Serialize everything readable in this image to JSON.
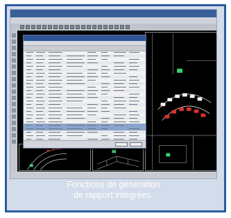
{
  "caption": {
    "line1": "Fonctions de génération",
    "line2": "de rapport intégrées."
  },
  "colors": {
    "frame_border": "#2c5aa0",
    "frame_background": "#d3dcea",
    "cad_background": "#000000",
    "cad_accent_red": "#e0302a",
    "cad_accent_green": "#3bd16f",
    "dialog_selection": "#8aa4cc"
  }
}
